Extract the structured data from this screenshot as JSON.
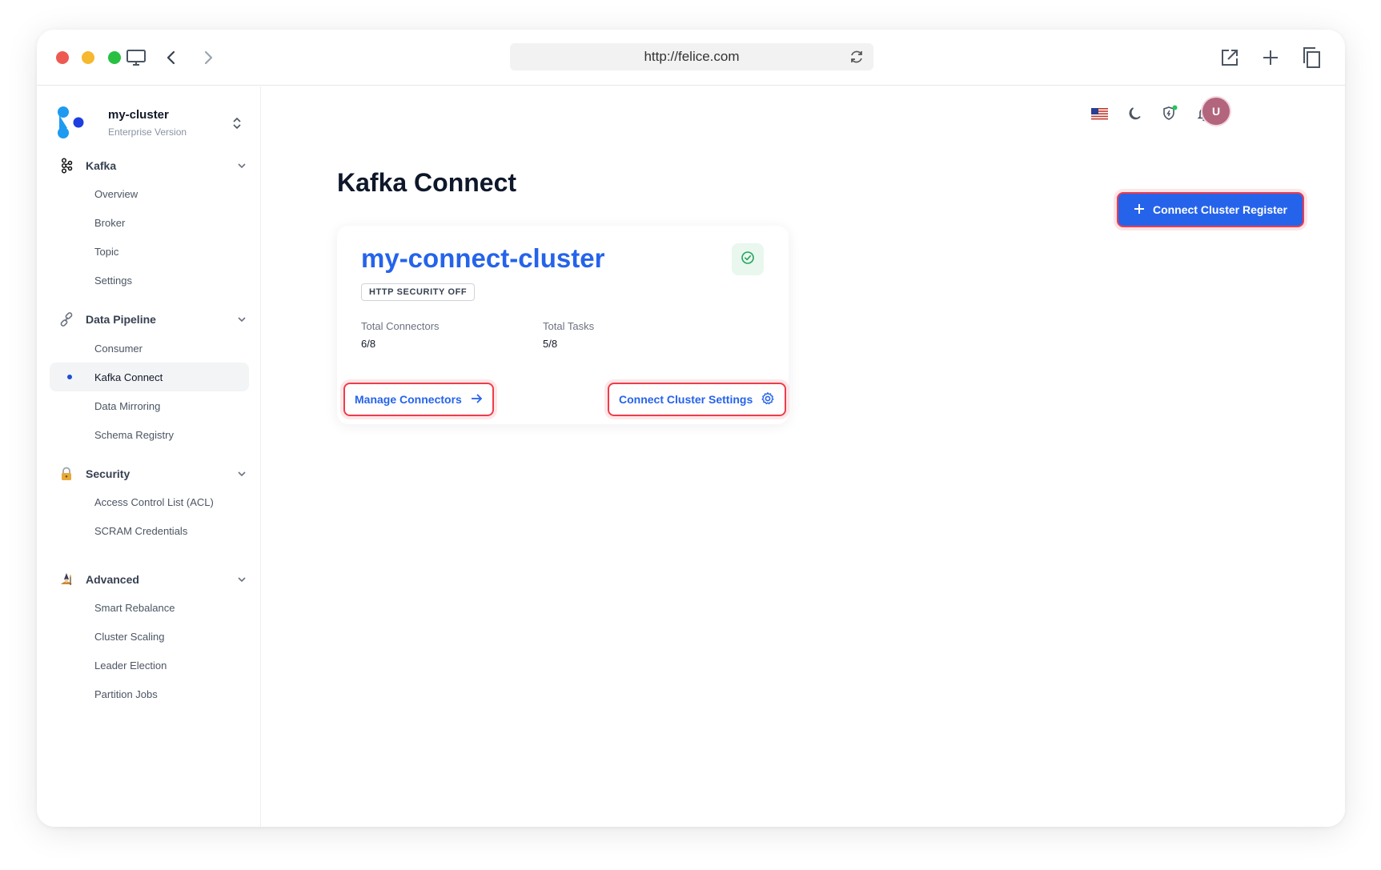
{
  "browser": {
    "url": "http://felice.com"
  },
  "sidebar": {
    "cluster_name": "my-cluster",
    "cluster_edition": "Enterprise Version",
    "groups": [
      {
        "label": "Kafka",
        "icon": "kafka-icon",
        "items": [
          "Overview",
          "Broker",
          "Topic",
          "Settings"
        ]
      },
      {
        "label": "Data Pipeline",
        "icon": "link-icon",
        "items": [
          "Consumer",
          "Kafka Connect",
          "Data Mirroring",
          "Schema Registry"
        ]
      },
      {
        "label": "Security",
        "icon": "lock-icon",
        "items": [
          "Access Control List (ACL)",
          "SCRAM Credentials"
        ]
      },
      {
        "label": "Advanced",
        "icon": "wizard-icon",
        "items": [
          "Smart Rebalance",
          "Cluster Scaling",
          "Leader Election",
          "Partition Jobs"
        ]
      }
    ],
    "active_item": "Kafka Connect"
  },
  "header": {
    "avatar_initial": "U",
    "icons": [
      "us-flag-icon",
      "moon-icon",
      "shield-icon",
      "bell-icon"
    ]
  },
  "main": {
    "title": "Kafka Connect",
    "register_button": "Connect Cluster Register",
    "card": {
      "name": "my-connect-cluster",
      "badge": "HTTP SECURITY OFF",
      "total_connectors_label": "Total Connectors",
      "total_connectors_value": "6/8",
      "total_tasks_label": "Total Tasks",
      "total_tasks_value": "5/8",
      "manage_button": "Manage Connectors",
      "settings_button": "Connect Cluster Settings"
    }
  },
  "colors": {
    "accent": "#2563eb",
    "highlight": "#ef3c4b",
    "success": "#22a55a"
  }
}
